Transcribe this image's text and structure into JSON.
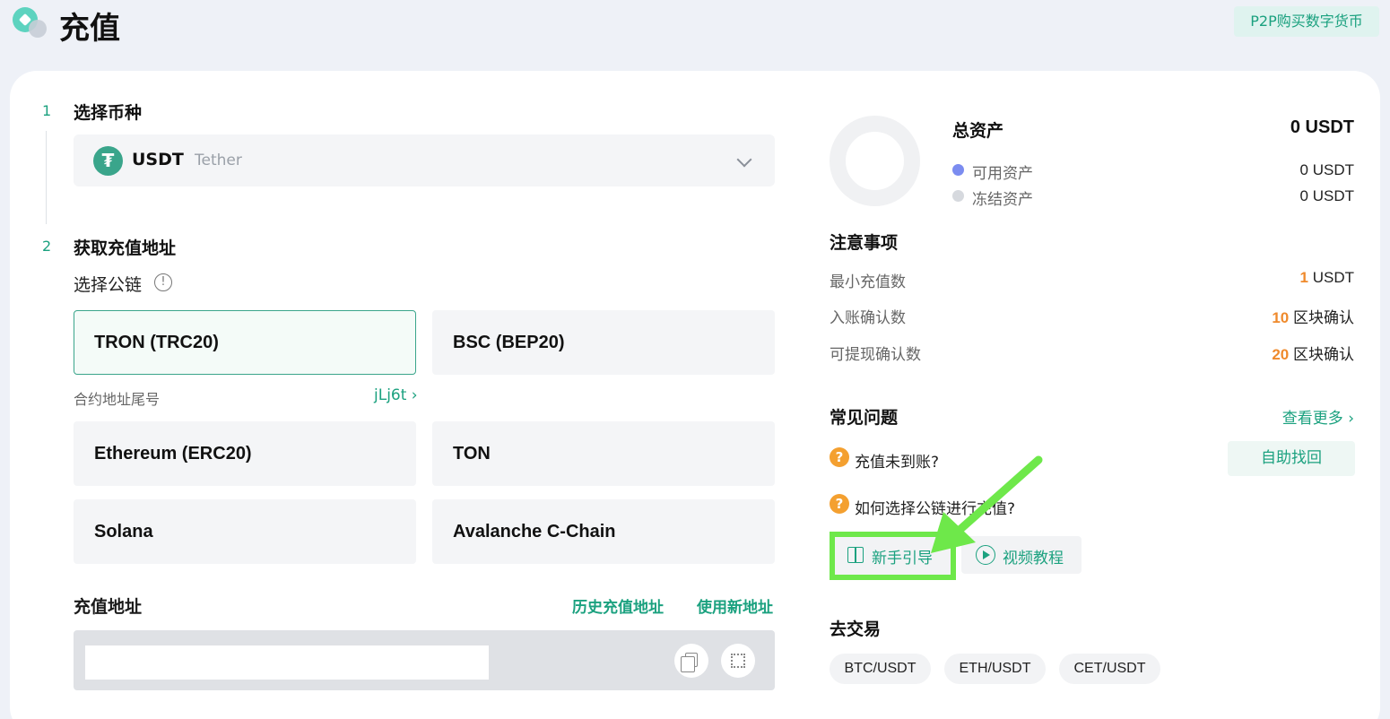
{
  "header": {
    "title": "充值",
    "p2p_button": "P2P购买数字货币"
  },
  "step1": {
    "num": "1",
    "title": "选择币种",
    "coin_symbol": "USDT",
    "coin_name": "Tether",
    "coin_icon": "tether-icon"
  },
  "step2": {
    "num": "2",
    "title": "获取充值地址",
    "chain_label": "选择公链",
    "networks": [
      {
        "label": "TRON (TRC20)",
        "selected": true
      },
      {
        "label": "BSC (BEP20)",
        "selected": false
      },
      {
        "label": "Ethereum (ERC20)",
        "selected": false
      },
      {
        "label": "TON",
        "selected": false
      },
      {
        "label": "Solana",
        "selected": false
      },
      {
        "label": "Avalanche C-Chain",
        "selected": false
      }
    ],
    "contract_label": "合约地址尾号",
    "contract_value": "jLj6t",
    "address_title": "充值地址",
    "history_link": "历史充值地址",
    "new_address_link": "使用新地址"
  },
  "assets": {
    "total_label": "总资产",
    "total_value": "0 USDT",
    "available_label": "可用资产",
    "available_value": "0 USDT",
    "available_color": "#7b8cf0",
    "frozen_label": "冻结资产",
    "frozen_value": "0 USDT",
    "frozen_color": "#d6d9de"
  },
  "notice": {
    "title": "注意事项",
    "rows": [
      {
        "label": "最小充值数",
        "num": "1",
        "unit": "USDT"
      },
      {
        "label": "入账确认数",
        "num": "10",
        "unit": "区块确认"
      },
      {
        "label": "可提现确认数",
        "num": "20",
        "unit": "区块确认"
      }
    ]
  },
  "faq": {
    "title": "常见问题",
    "more": "查看更多",
    "q1": "充值未到账?",
    "q1_button": "自助找回",
    "q2": "如何选择公链进行充值?",
    "guide_button": "新手引导",
    "video_button": "视频教程"
  },
  "trade": {
    "title": "去交易",
    "pairs": [
      "BTC/USDT",
      "ETH/USDT",
      "CET/USDT"
    ]
  },
  "colors": {
    "accent": "#1ba17f",
    "orange": "#ef8a2c",
    "highlight": "#6ee84a"
  }
}
